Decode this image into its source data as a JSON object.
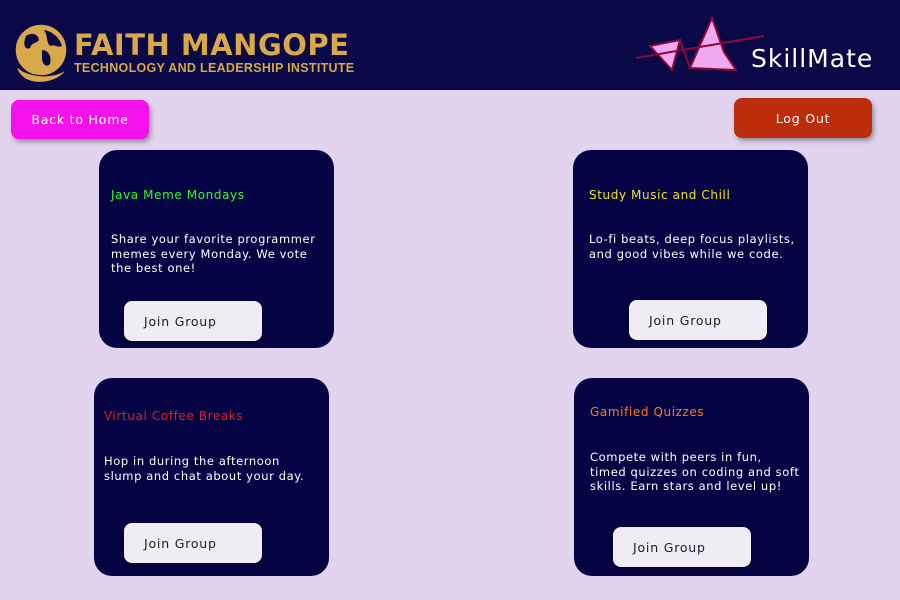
{
  "header": {
    "logo_title": "FAITH MANGOPE",
    "logo_subtitle": "TECHNOLOGY AND LEADERSHIP INSTITUTE",
    "brand_name": "SkillMate",
    "logo_icon": "globe-hand-icon",
    "brand_icon": "pink-peaks-icon"
  },
  "nav": {
    "back_label": "Back to Home",
    "logout_label": "Log Out"
  },
  "colors": {
    "header_bg": "#0a0847",
    "page_bg": "#e2d4ee",
    "card_bg": "#060344",
    "back_button": "#f511ea",
    "logout_button": "#bd2c0b",
    "logo_gold": "#d9a84a"
  },
  "groups": [
    {
      "title": "Java Meme Mondays",
      "title_color": "#2aff2a",
      "description": "Share your favorite programmer memes every Monday. We vote the best one!",
      "button_label": "Join Group"
    },
    {
      "title": "Study Music and Chill",
      "title_color": "#f2e21b",
      "description": "Lo-fi beats, deep focus playlists, and good vibes while we code.",
      "button_label": "Join Group"
    },
    {
      "title": "Virtual Coffee Breaks",
      "title_color": "#e0201e",
      "description": "Hop in during the afternoon slump and chat about your day.",
      "button_label": "Join Group"
    },
    {
      "title": "Gamified Quizzes",
      "title_color": "#ff7a1a",
      "description": "Compete with peers in fun, timed quizzes on coding and soft skills. Earn stars and level up!",
      "button_label": "Join Group"
    }
  ]
}
